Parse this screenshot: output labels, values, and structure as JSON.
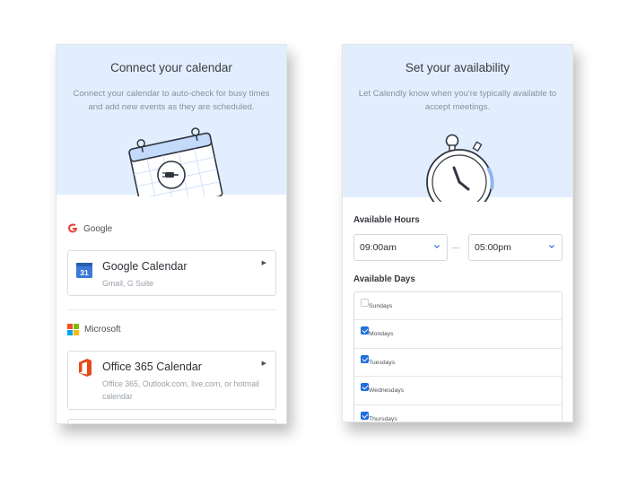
{
  "connect": {
    "title": "Connect your calendar",
    "description": "Connect your calendar to auto-check for busy times and add new events as they are scheduled.",
    "google": {
      "provider_label": "Google",
      "option_title": "Google Calendar",
      "option_subtitle": "Gmail, G Suite",
      "icon_text": "31"
    },
    "microsoft": {
      "provider_label": "Microsoft",
      "option_title": "Office 365 Calendar",
      "option_subtitle": "Office 365, Outlook.com, live.com, or hotmail calendar"
    }
  },
  "availability": {
    "title": "Set your availability",
    "description": "Let Calendly know when you're typically available to accept meetings.",
    "hours_label": "Available Hours",
    "start_time": "09:00am",
    "end_time": "05:00pm",
    "days_label": "Available Days",
    "days": [
      {
        "name": "Sundays",
        "checked": false
      },
      {
        "name": "Mondays",
        "checked": true
      },
      {
        "name": "Tuesdays",
        "checked": true
      },
      {
        "name": "Wednesdays",
        "checked": true
      },
      {
        "name": "Thursdays",
        "checked": true
      }
    ]
  },
  "colors": {
    "hero_bg": "#e2eefd",
    "accent_blue": "#1f6fdc",
    "google_red": "#ea4335",
    "office_orange": "#e64a19"
  },
  "icons": [
    "calendar-illustration-icon",
    "plug-icon",
    "google-g-icon",
    "google-calendar-icon",
    "microsoft-logo-icon",
    "office-icon",
    "caret-right-icon",
    "stopwatch-illustration-icon",
    "chevron-down-icon",
    "checkbox-icon"
  ]
}
